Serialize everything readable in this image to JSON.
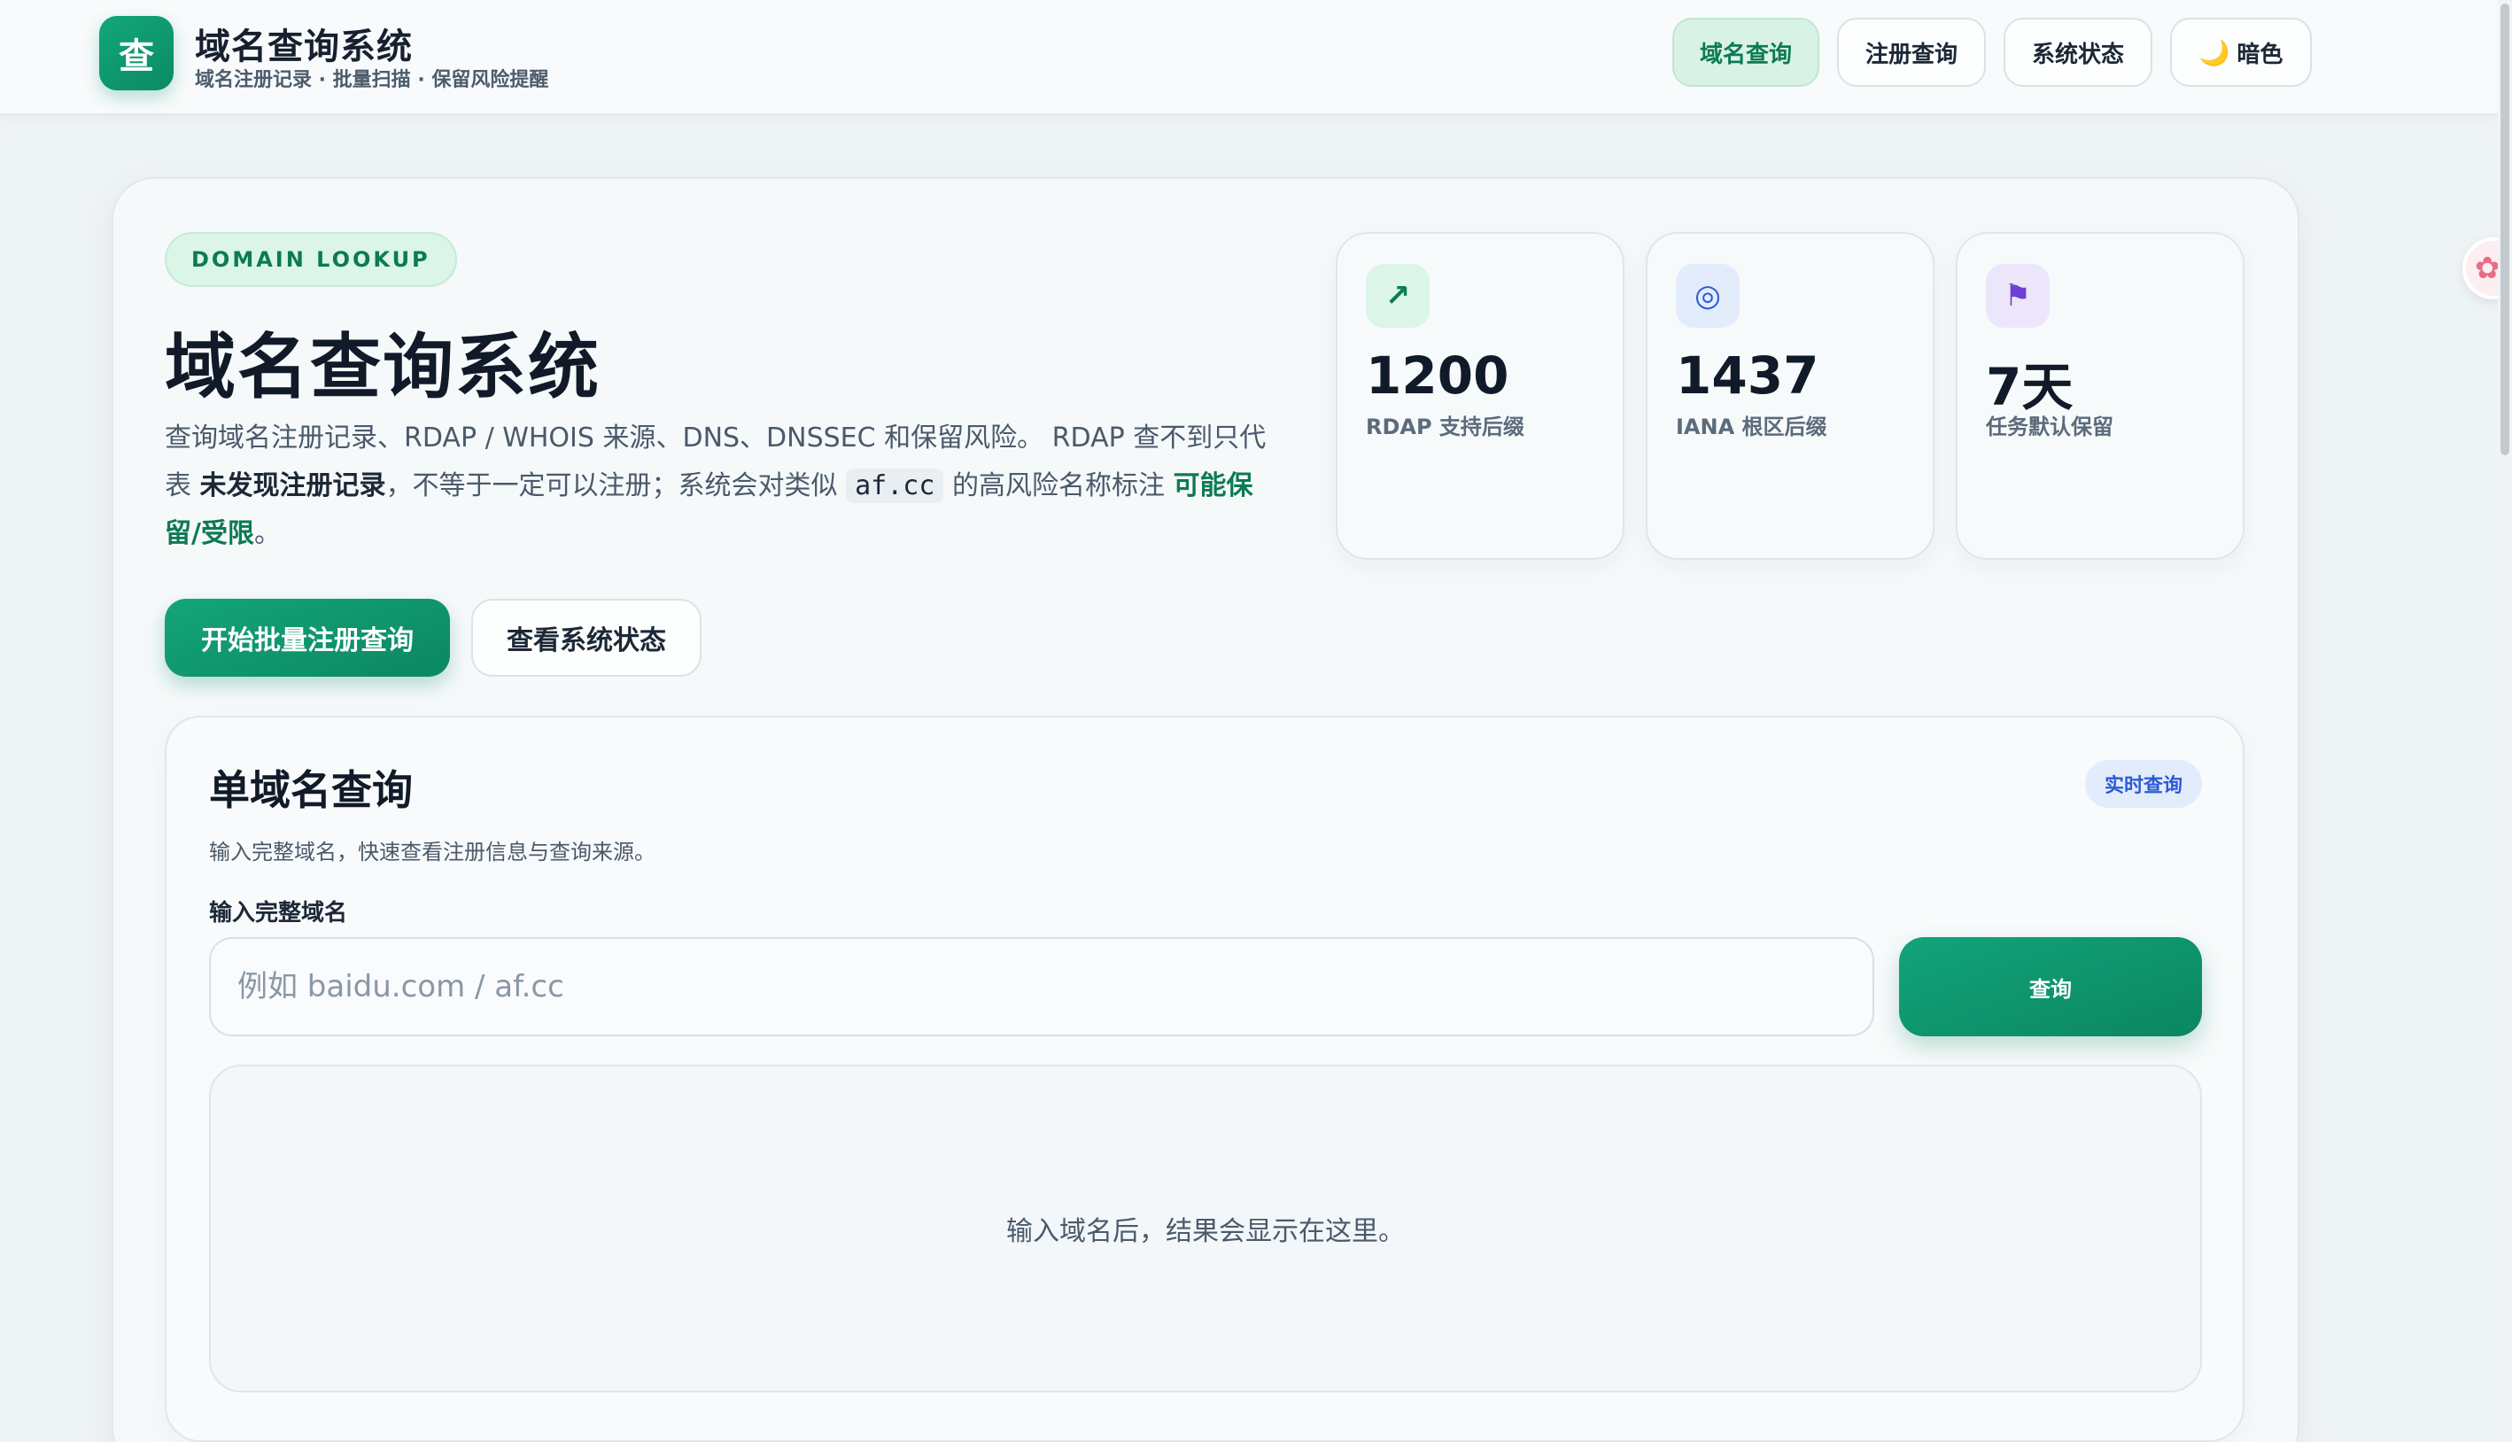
{
  "header": {
    "logo_char": "查",
    "title": "域名查询系统",
    "subtitle": "域名注册记录 · 批量扫描 · 保留风险提醒",
    "nav": [
      {
        "label": "域名查询",
        "active": true
      },
      {
        "label": "注册查询",
        "active": false
      },
      {
        "label": "系统状态",
        "active": false
      },
      {
        "label": "暗色",
        "icon": "moon-icon",
        "icon_glyph": "🌙",
        "active": false
      }
    ]
  },
  "hero": {
    "pill": "DOMAIN LOOKUP",
    "title": "域名查询系统",
    "desc_part1": "查询域名注册记录、RDAP / WHOIS 来源、DNS、DNSSEC 和保留风险。 RDAP 查不到只代表 ",
    "desc_strong": "未发现注册记录",
    "desc_part2": "，不等于一定可以注册；系统会对类似 ",
    "desc_code": "af.cc",
    "desc_part3": " 的高风险名称标注 ",
    "desc_green": "可能保留/受限",
    "desc_end": "。",
    "primary_button": "开始批量注册查询",
    "secondary_button": "查看系统状态"
  },
  "stats": [
    {
      "value": "1200",
      "label": "RDAP 支持后缀",
      "icon": "arrow-up-right-icon",
      "icon_glyph": "↗",
      "icon_color": "#0c7a55",
      "icon_bg": "#dbf5e8"
    },
    {
      "value": "1437",
      "label": "IANA 根区后缀",
      "icon": "target-icon",
      "icon_glyph": "◎",
      "icon_color": "#2a5bd7",
      "icon_bg": "#e3ecfb"
    },
    {
      "value": "7天",
      "label": "任务默认保留",
      "icon": "flag-icon",
      "icon_glyph": "⚑",
      "icon_color": "#6d3fd4",
      "icon_bg": "#ece6fb"
    }
  ],
  "lookup": {
    "title": "单域名查询",
    "badge": "实时查询",
    "desc": "输入完整域名，快速查看注册信息与查询来源。",
    "field_label": "输入完整域名",
    "input_value": "",
    "input_placeholder": "例如 baidu.com / af.cc",
    "query_button": "查询",
    "result_empty": "输入域名后，结果会显示在这里。"
  },
  "colors": {
    "accent": "#0c7a55",
    "primary_button": "#12a47a",
    "badge_blue": "#2a5bd7",
    "background": "#eef3f5"
  }
}
